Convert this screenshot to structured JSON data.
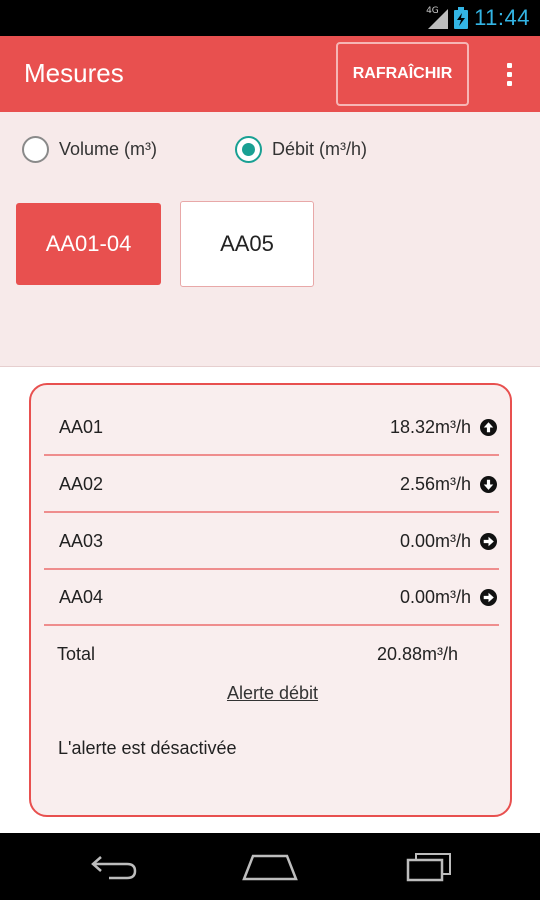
{
  "status_bar": {
    "network_label": "4G",
    "time": "11:44",
    "signal_icon": "signal-icon",
    "battery_icon": "battery-charging-icon",
    "accent_color": "#33b5e5"
  },
  "app_bar": {
    "title": "Mesures",
    "refresh_label": "RAFRAÎCHIR",
    "overflow_icon": "overflow-menu-icon",
    "color": "#e8504f"
  },
  "mode": {
    "options": [
      {
        "label": "Volume (m³)",
        "selected": false
      },
      {
        "label": "Débit (m³/h)",
        "selected": true
      }
    ],
    "radio_color": "#19a093"
  },
  "groups": [
    {
      "label": "AA01-04",
      "selected": true
    },
    {
      "label": "AA05",
      "selected": false
    }
  ],
  "measures": {
    "rows": [
      {
        "name": "AA01",
        "value": "18.32m³/h",
        "trend_icon": "arrow-up-circle-icon"
      },
      {
        "name": "AA02",
        "value": "2.56m³/h",
        "trend_icon": "arrow-down-circle-icon"
      },
      {
        "name": "AA03",
        "value": "0.00m³/h",
        "trend_icon": "arrow-right-circle-icon"
      },
      {
        "name": "AA04",
        "value": "0.00m³/h",
        "trend_icon": "arrow-right-circle-icon"
      }
    ],
    "total_label": "Total",
    "total_value": "20.88m³/h",
    "alert_link": "Alerte débit",
    "alert_status": "L'alerte est désactivée"
  },
  "nav_bar": {
    "back_icon": "back-icon",
    "home_icon": "home-icon",
    "recents_icon": "recent-apps-icon"
  }
}
